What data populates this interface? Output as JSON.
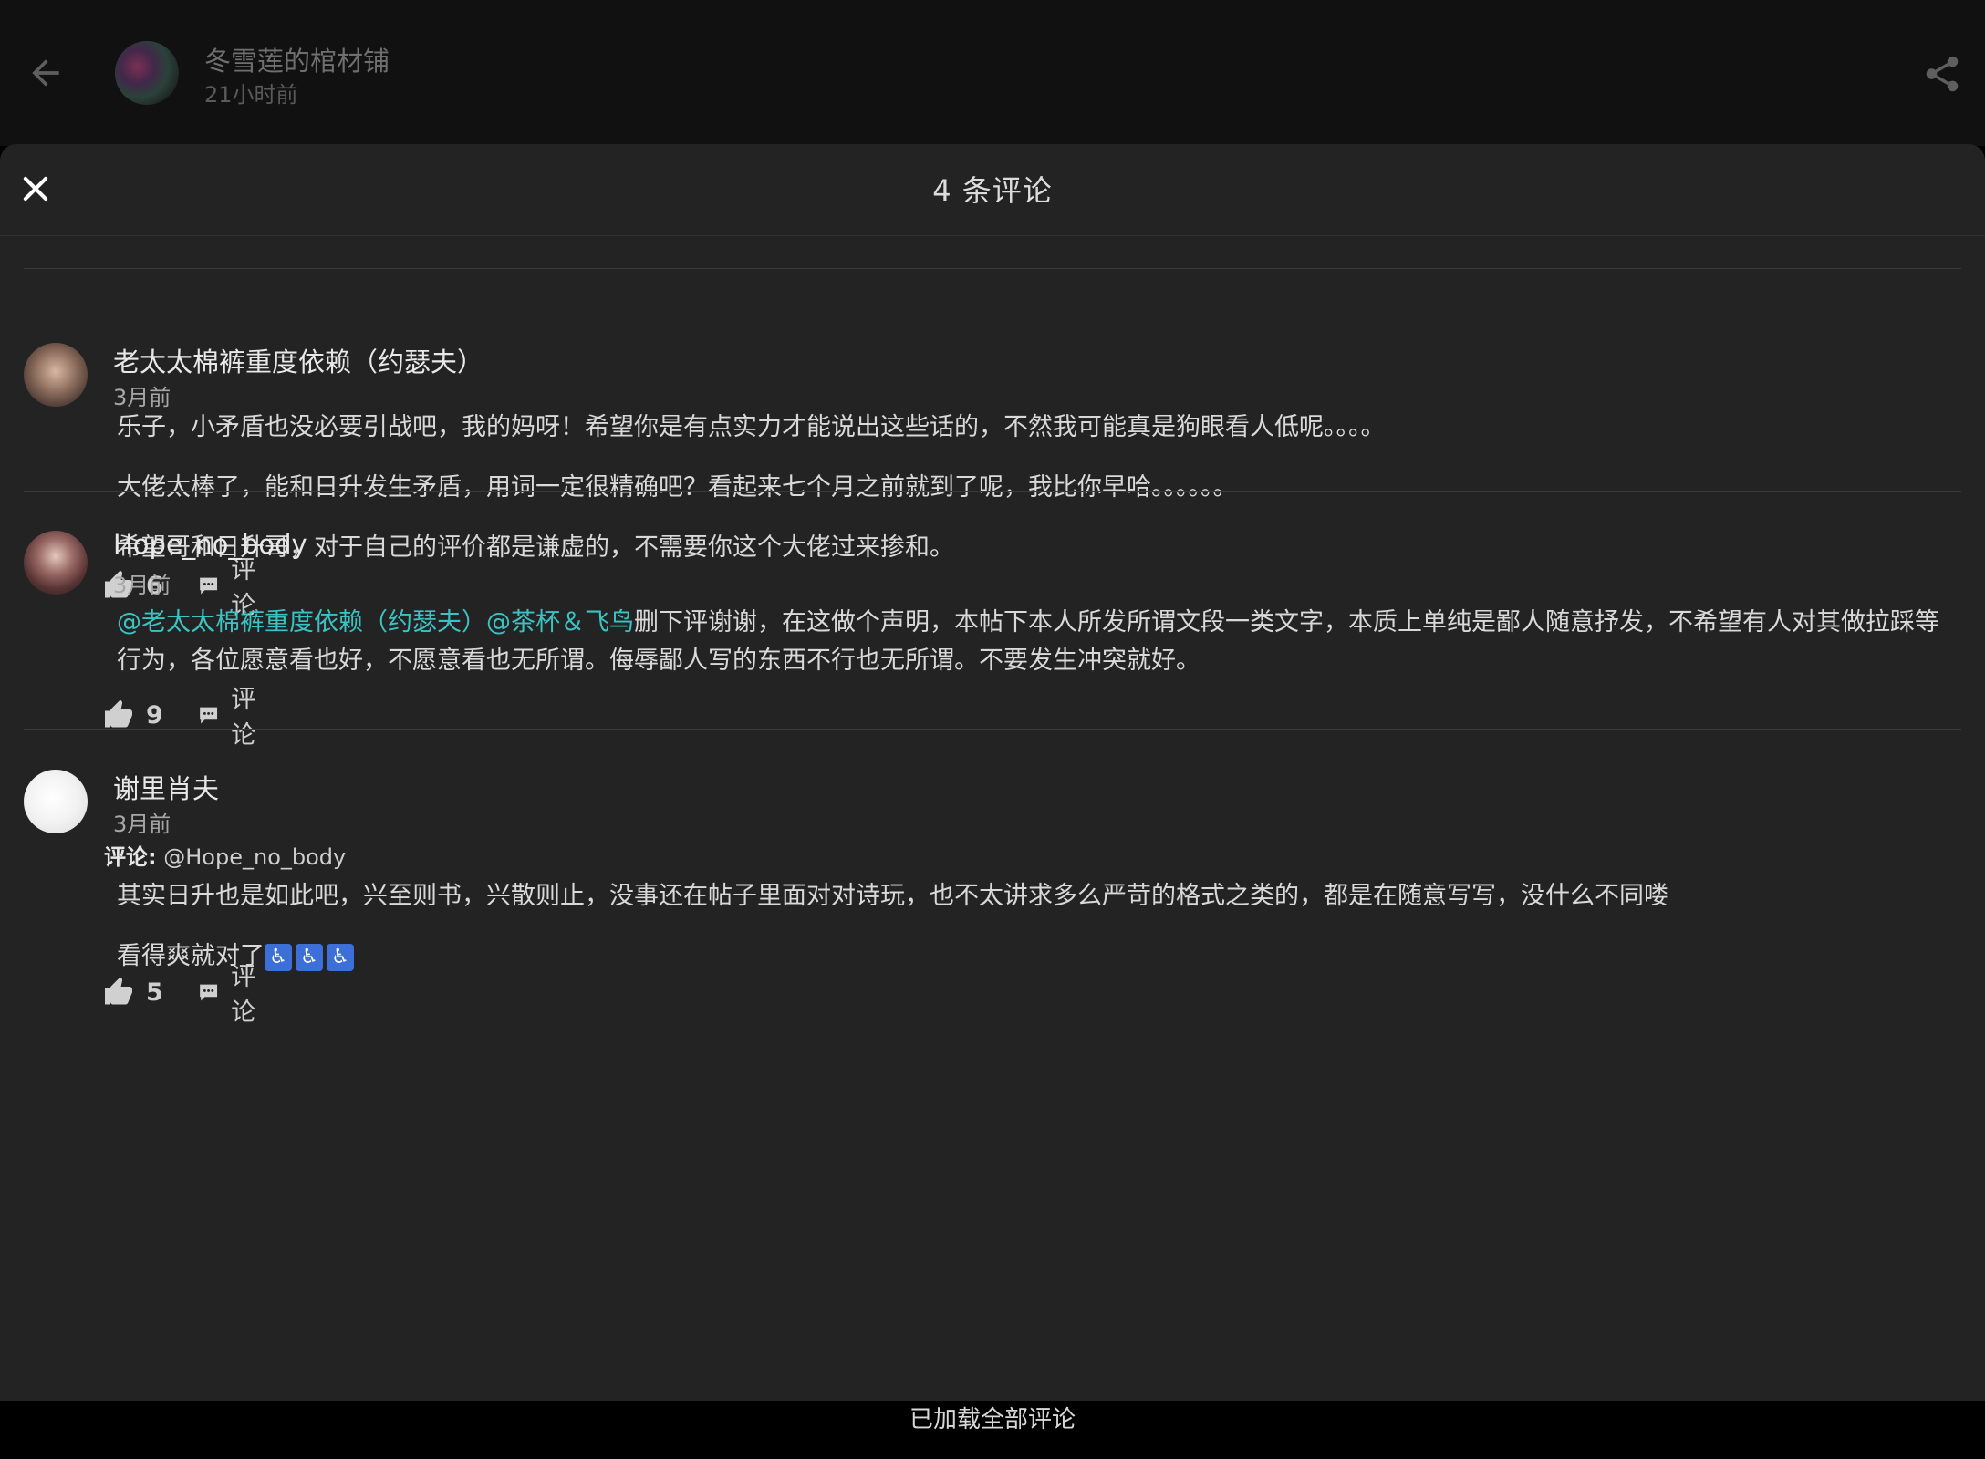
{
  "topbar": {
    "title": "冬雪莲的棺材铺",
    "time": "21小时前"
  },
  "sheet": {
    "title": "4 条评论"
  },
  "comments": [
    {
      "author": "老太太棉裤重度依赖（约瑟夫）",
      "time": "3月前",
      "paragraphs": [
        "乐子，小矛盾也没必要引战吧，我的妈呀！希望你是有点实力才能说出这些话的，不然我可能真是狗眼看人低呢。。。。",
        "大佬太棒了，能和日升发生矛盾，用词一定很精确吧？看起来七个月之前就到了呢，我比你早哈。。。。。。",
        "希望哥和日升哥，对于自己的评价都是谦虚的，不需要你这个大佬过来掺和。"
      ],
      "likes": "6",
      "comment_label": "评论"
    },
    {
      "author": "Hope_no_body",
      "time": "3月前",
      "mentions": [
        "@老太太棉裤重度依赖（约瑟夫）",
        "@茶杯＆飞鸟"
      ],
      "body": "删下评谢谢，在这做个声明，本帖下本人所发所谓文段一类文字，本质上单纯是鄙人随意抒发，不希望有人对其做拉踩等行为，各位愿意看也好，不愿意看也无所谓。侮辱鄙人写的东西不行也无所谓。不要发生冲突就好。",
      "likes": "9",
      "comment_label": "评论"
    },
    {
      "author": "谢里肖夫",
      "time": "3月前",
      "reply_label": "评论:",
      "reply_target": "@Hope_no_body",
      "paragraphs": [
        "其实日升也是如此吧，兴至则书，兴散则止，没事还在帖子里面对对诗玩，也不太讲求多么严苛的格式之类的，都是在随意写写，没什么不同喽",
        "看得爽就对了"
      ],
      "emoji": [
        "♿",
        "♿",
        "♿"
      ],
      "likes": "5",
      "comment_label": "评论"
    }
  ],
  "footer": {
    "text": "已加载全部评论"
  },
  "colors": {
    "sheet_bg": "#232323",
    "mention": "#3bc3c4",
    "emoji_bg": "#3d6fd8"
  }
}
